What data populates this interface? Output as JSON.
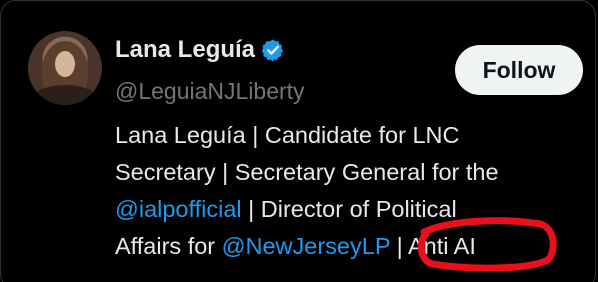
{
  "profile": {
    "display_name": "Lana Leguía",
    "handle": "@LeguiaNJLiberty",
    "follow_label": "Follow",
    "verified_color": "#1d9bf0",
    "bio": {
      "line1": "Lana Leguía | Candidate for LNC",
      "line2": "Secretary | Secretary General for the",
      "line3_mention": "@ialpofficial",
      "line3_rest": " | Director of Political",
      "line4_start": "Affairs for ",
      "line4_mention": "@NewJerseyLP",
      "line4_rest": " | Anti AI"
    }
  },
  "colors": {
    "background": "#000000",
    "text": "#e7e9ea",
    "muted": "#71767b",
    "link": "#1d9bf0",
    "annotation": "#e8101a"
  }
}
